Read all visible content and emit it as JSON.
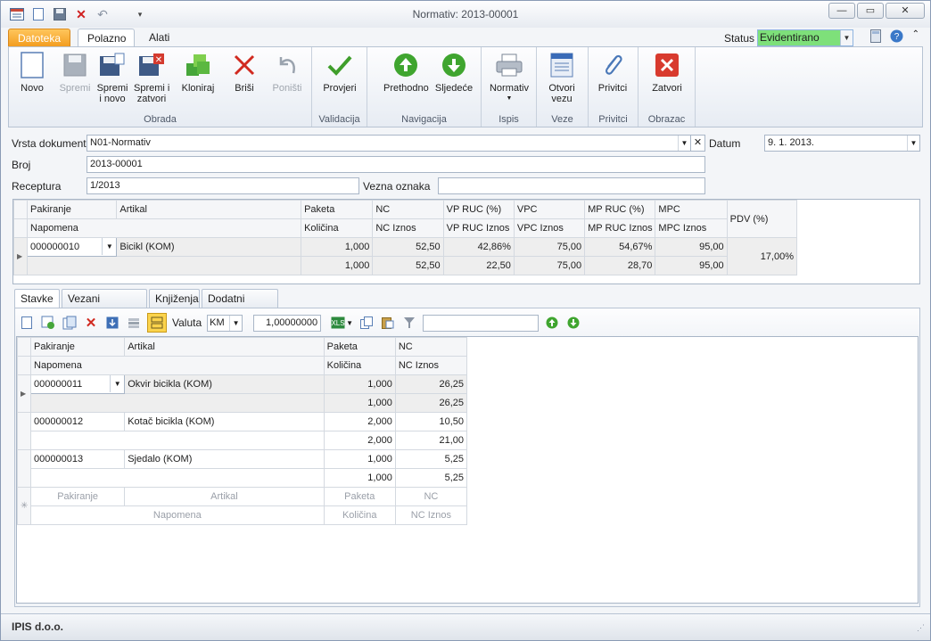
{
  "window": {
    "title": "Normativ: 2013-00001",
    "controls": {
      "min": "—",
      "max": "▭",
      "close": "✕"
    }
  },
  "ribbon_tabs": [
    "Datoteka",
    "Polazno",
    "Alati"
  ],
  "status": {
    "label": "Status",
    "value": "Evidentirano",
    "color": "#7ee07a"
  },
  "groups": [
    {
      "label": "Obrada",
      "buttons": [
        "Novo",
        "Spremi",
        "Spremi\ni novo",
        "Spremi i\nzatvori",
        "Kloniraj",
        "Briši",
        "Poništi"
      ]
    },
    {
      "label": "Validacija",
      "buttons": [
        "Provjeri"
      ]
    },
    {
      "label": "Navigacija",
      "buttons": [
        "Prethodno",
        "Sljedeće"
      ]
    },
    {
      "label": "Ispis",
      "buttons": [
        "Normativ"
      ]
    },
    {
      "label": "Veze",
      "buttons": [
        "Otvori\nvezu"
      ]
    },
    {
      "label": "Privitci",
      "buttons": [
        "Privitci"
      ]
    },
    {
      "label": "Obrazac",
      "buttons": [
        "Zatvori"
      ]
    }
  ],
  "form": {
    "vrsta_label": "Vrsta dokumenta",
    "vrsta_value": "N01-Normativ",
    "datum_label": "Datum",
    "datum_value": "9. 1. 2013.",
    "broj_label": "Broj",
    "broj_value": "2013-00001",
    "receptura_label": "Receptura",
    "receptura_value": "1/2013",
    "vezna_label": "Vezna oznaka",
    "vezna_value": ""
  },
  "header_grid": {
    "h1": [
      "Pakiranje",
      "Artikal",
      "Paketa",
      "NC",
      "VP RUC (%)",
      "VPC",
      "MP RUC (%)",
      "MPC"
    ],
    "h2": [
      "Napomena",
      "",
      "Količina",
      "NC Iznos",
      "VP RUC Iznos",
      "VPC Iznos",
      "MP RUC Iznos",
      "MPC Iznos"
    ],
    "pdv_header": "PDV (%)",
    "r1": [
      "000000010",
      "Bicikl (KOM)",
      "1,000",
      "52,50",
      "42,86%",
      "75,00",
      "54,67%",
      "95,00"
    ],
    "r2": [
      "",
      "",
      "1,000",
      "52,50",
      "22,50",
      "75,00",
      "28,70",
      "95,00"
    ],
    "pdv": "17,00%"
  },
  "subtabs": [
    "Stavke",
    "Vezani dokumenti",
    "Knjiženja",
    "Dodatni podaci"
  ],
  "toolbar": {
    "valuta_label": "Valuta",
    "valuta_value": "KM",
    "rate": "1,00000000",
    "filter_value": ""
  },
  "items": {
    "h1": [
      "Pakiranje",
      "Artikal",
      "Paketa",
      "NC"
    ],
    "h2": [
      "Napomena",
      "",
      "Količina",
      "NC Iznos"
    ],
    "rows": [
      {
        "pak": "000000011",
        "art": "Okvir bicikla (KOM)",
        "paketa": "1,000",
        "nc": "26,25",
        "kol": "1,000",
        "iznos": "26,25"
      },
      {
        "pak": "000000012",
        "art": "Kotač bicikla (KOM)",
        "paketa": "2,000",
        "nc": "10,50",
        "kol": "2,000",
        "iznos": "21,00"
      },
      {
        "pak": "000000013",
        "art": "Sjedalo (KOM)",
        "paketa": "1,000",
        "nc": "5,25",
        "kol": "1,000",
        "iznos": "5,25"
      }
    ],
    "new_row": {
      "pak": "Pakiranje",
      "art": "Artikal",
      "paketa": "Paketa",
      "nc": "NC",
      "nap": "Napomena",
      "kol": "Količina",
      "iznos": "NC Iznos"
    }
  },
  "footer": "IPIS d.o.o."
}
